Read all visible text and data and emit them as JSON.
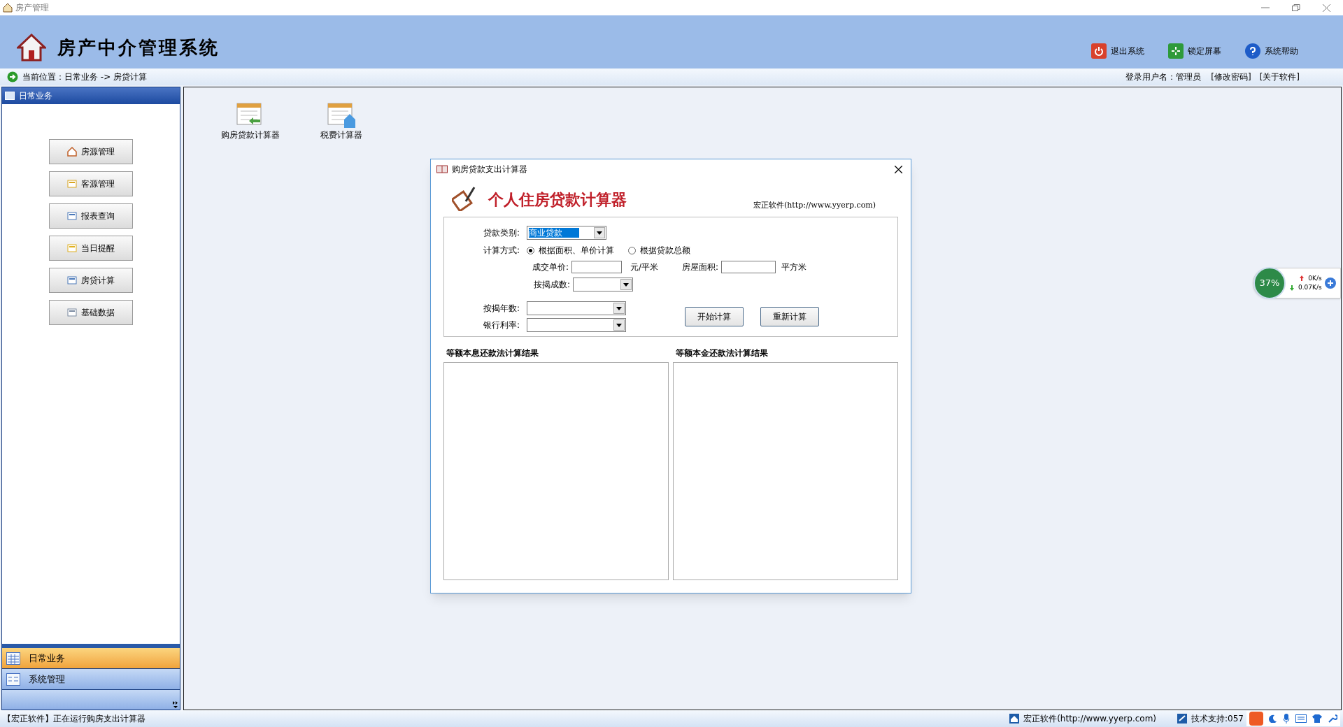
{
  "window": {
    "title": "房产管理"
  },
  "header": {
    "title": "房产中介管理系统",
    "actions": [
      {
        "kind": "exit",
        "label": "退出系统"
      },
      {
        "kind": "lock",
        "label": "锁定屏幕"
      },
      {
        "kind": "help",
        "label": "系统帮助"
      }
    ]
  },
  "breadcrumb": {
    "label": "当前位置：",
    "path": "日常业务 -> 房贷计算",
    "user_label": "登录用户名：",
    "user": "管理员",
    "links": [
      "[修改密码]",
      "[关于软件]"
    ]
  },
  "sidebar": {
    "title": "日常业务",
    "buttons": [
      {
        "kind": "house",
        "label": "房源管理"
      },
      {
        "kind": "client",
        "label": "客源管理"
      },
      {
        "kind": "report",
        "label": "报表查询"
      },
      {
        "kind": "remind",
        "label": "当日提醒"
      },
      {
        "kind": "loan",
        "label": "房贷计算"
      },
      {
        "kind": "data",
        "label": "基础数据"
      }
    ],
    "nav": [
      {
        "kind": "grid",
        "label": "日常业务",
        "selected": true
      },
      {
        "kind": "panel",
        "label": "系统管理",
        "selected": false
      }
    ]
  },
  "desktop": {
    "icons": [
      {
        "kind": "loan",
        "label": "购房贷款计算器"
      },
      {
        "kind": "tax",
        "label": "税费计算器"
      }
    ]
  },
  "dialog": {
    "title": "购房贷款支出计算器",
    "banner": "个人住房贷款计算器",
    "vendor": "宏正软件(http://www.yyerp.com)",
    "loan_type": {
      "label": "贷款类别:",
      "value": "商业贷款"
    },
    "method": {
      "label": "计算方式:",
      "options": [
        {
          "label": "根据面积、单价计算",
          "selected": true
        },
        {
          "label": "根据贷款总额",
          "selected": false
        }
      ]
    },
    "unit_price": {
      "label": "成交单价:",
      "unit": "元/平米"
    },
    "area": {
      "label": "房屋面积:",
      "unit": "平方米"
    },
    "ratio": {
      "label": "按揭成数:"
    },
    "years": {
      "label": "按揭年数:"
    },
    "rate": {
      "label": "银行利率:"
    },
    "buttons": [
      "开始计算",
      "重新计算"
    ],
    "results": [
      "等额本息还款法计算结果",
      "等额本金还款法计算结果"
    ]
  },
  "monitor": {
    "percent": "37%",
    "up": "0K/s",
    "down": "0.07K/s"
  },
  "status_bar": {
    "message": "【宏正软件】正在运行购房支出计算器",
    "vendor": "宏正软件(http://www.yyerp.com)",
    "support": "技术支持:057"
  }
}
